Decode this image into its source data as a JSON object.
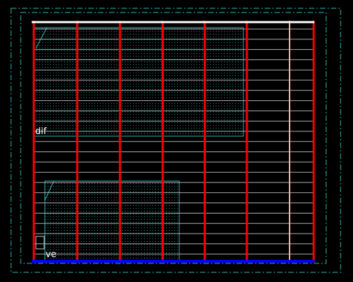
{
  "layout_view": {
    "colors": {
      "background": "#000000",
      "boundary": "#2fb7b0",
      "metal_rail": "#ff0000",
      "track_line": "#c8c8c8",
      "diffusion": "#2fb7b0",
      "top_rail": "#ffffff",
      "bottom_rail": "#0000ff",
      "pale_rail": "#ffb6b6"
    },
    "region_labels": {
      "diffusion": "dif",
      "via": "ve"
    }
  }
}
